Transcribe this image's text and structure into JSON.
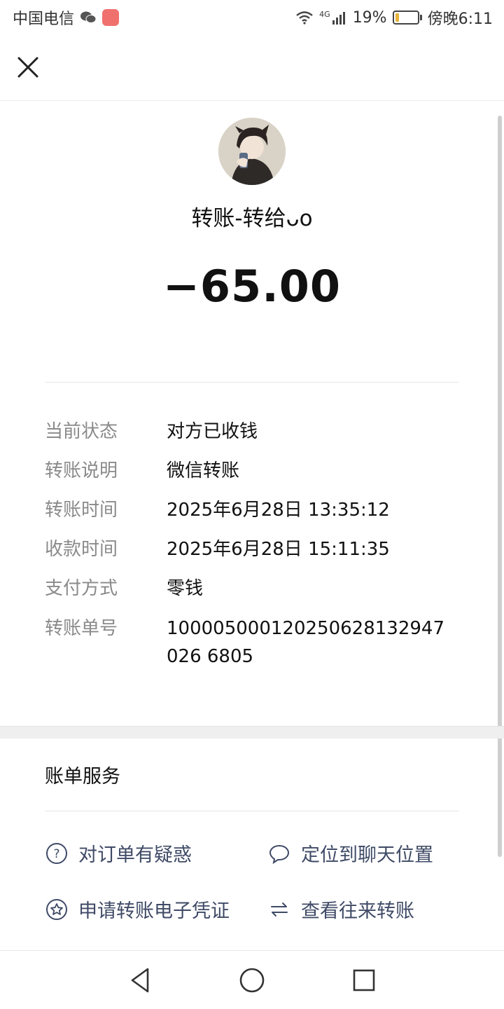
{
  "status_bar": {
    "carrier": "中国电信",
    "network": "4G",
    "battery": "19%",
    "battery_level": 0.19,
    "time": "傍晚6:11"
  },
  "header": {
    "close_icon": "close-icon"
  },
  "transfer": {
    "title": "转账-转给ᴗo",
    "amount": "−65.00"
  },
  "details": [
    {
      "label": "当前状态",
      "value": "对方已收钱"
    },
    {
      "label": "转账说明",
      "value": "微信转账"
    },
    {
      "label": "转账时间",
      "value": "2025年6月28日 13:35:12"
    },
    {
      "label": "收款时间",
      "value": "2025年6月28日 15:11:35"
    },
    {
      "label": "支付方式",
      "value": "零钱"
    },
    {
      "label": "转账单号",
      "value": "100005000120250628132947026 6805"
    }
  ],
  "services": {
    "title": "账单服务",
    "items": [
      {
        "label": "对订单有疑惑",
        "icon": "question-circle-icon"
      },
      {
        "label": "定位到聊天位置",
        "icon": "chat-bubble-icon"
      },
      {
        "label": "申请转账电子凭证",
        "icon": "star-circle-icon"
      },
      {
        "label": "查看往来转账",
        "icon": "swap-arrows-icon"
      }
    ]
  },
  "nav": {
    "back": "back-triangle-icon",
    "home": "home-circle-icon",
    "recents": "recents-square-icon"
  },
  "colors": {
    "accent_link": "#3f4a66",
    "label_gray": "#8a8a8a",
    "battery": "#e8b33a"
  }
}
